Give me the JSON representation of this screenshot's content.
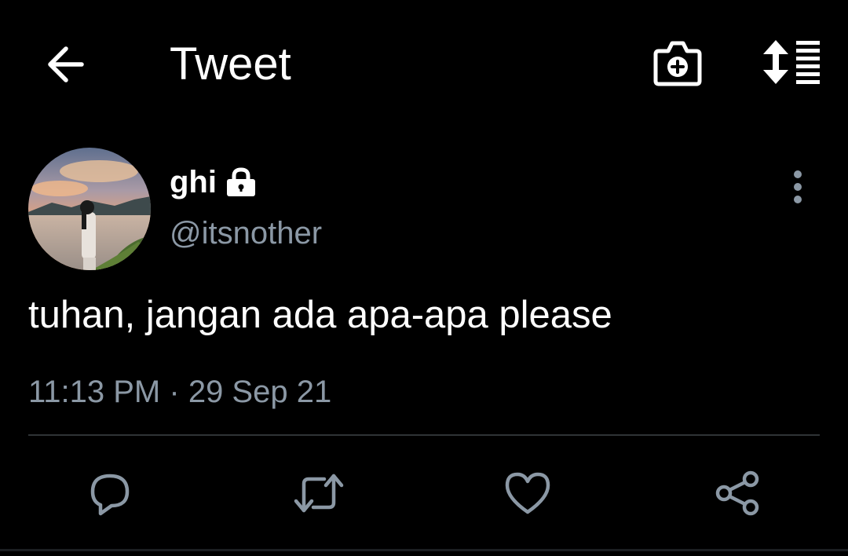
{
  "header": {
    "title": "Tweet",
    "back_icon": "arrow-left-icon",
    "camera_icon": "camera-add-icon",
    "sort_icon": "sort-replies-icon"
  },
  "tweet": {
    "author": {
      "display_name": "ghi",
      "handle": "@itsnother",
      "protected": true
    },
    "text": "tuhan, jangan ada apa-apa please",
    "time": "11:13 PM",
    "separator": "·",
    "date": "29 Sep 21"
  },
  "actions": {
    "reply_icon": "reply-icon",
    "retweet_icon": "retweet-icon",
    "like_icon": "heart-icon",
    "share_icon": "share-icon"
  },
  "colors": {
    "background": "#000000",
    "primary_text": "#ffffff",
    "secondary_text": "#8b98a5",
    "icon_gray": "#8b98a5",
    "divider": "#2f3336"
  }
}
